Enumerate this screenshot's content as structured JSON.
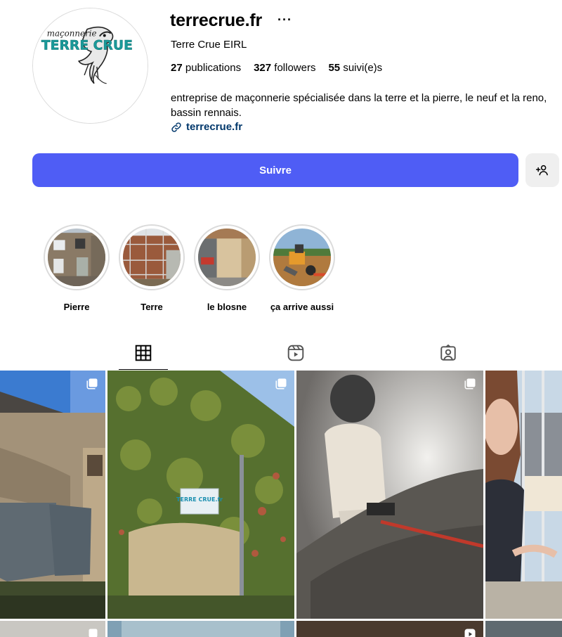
{
  "profile": {
    "username": "terrecrue.fr",
    "full_name": "Terre Crue EIRL",
    "stats": {
      "posts_count": "27",
      "posts_label": "publications",
      "followers_count": "327",
      "followers_label": "followers",
      "following_count": "55",
      "following_label": "suivi(e)s"
    },
    "bio": "entreprise de maçonnerie spécialisée dans la terre et la pierre, le neuf et la reno, bassin rennais.",
    "link": "terrecrue.fr",
    "logo": {
      "script_text": "maçonnerie",
      "brand_text": "TERRE CRUE"
    }
  },
  "actions": {
    "follow_label": "Suivre",
    "suggest_icon": "add-person-icon",
    "more_icon": "ellipsis-icon"
  },
  "highlights": [
    {
      "label": "Pierre"
    },
    {
      "label": "Terre"
    },
    {
      "label": "le blosne"
    },
    {
      "label": "ça arrive aussi"
    }
  ],
  "tabs": [
    {
      "name": "posts",
      "icon": "grid-icon",
      "active": true
    },
    {
      "name": "reels",
      "icon": "reels-icon",
      "active": false
    },
    {
      "name": "tagged",
      "icon": "tagged-icon",
      "active": false
    }
  ],
  "posts": [
    {
      "type": "carousel",
      "sign_text": ""
    },
    {
      "type": "carousel",
      "sign_text": "TERRE CRUE.fr"
    },
    {
      "type": "carousel",
      "sign_text": ""
    },
    {
      "type": "reel",
      "sign_text": ""
    }
  ],
  "colors": {
    "accent": "#4f5df5",
    "link": "#00376b",
    "brand_teal": "#1a9a9a"
  }
}
